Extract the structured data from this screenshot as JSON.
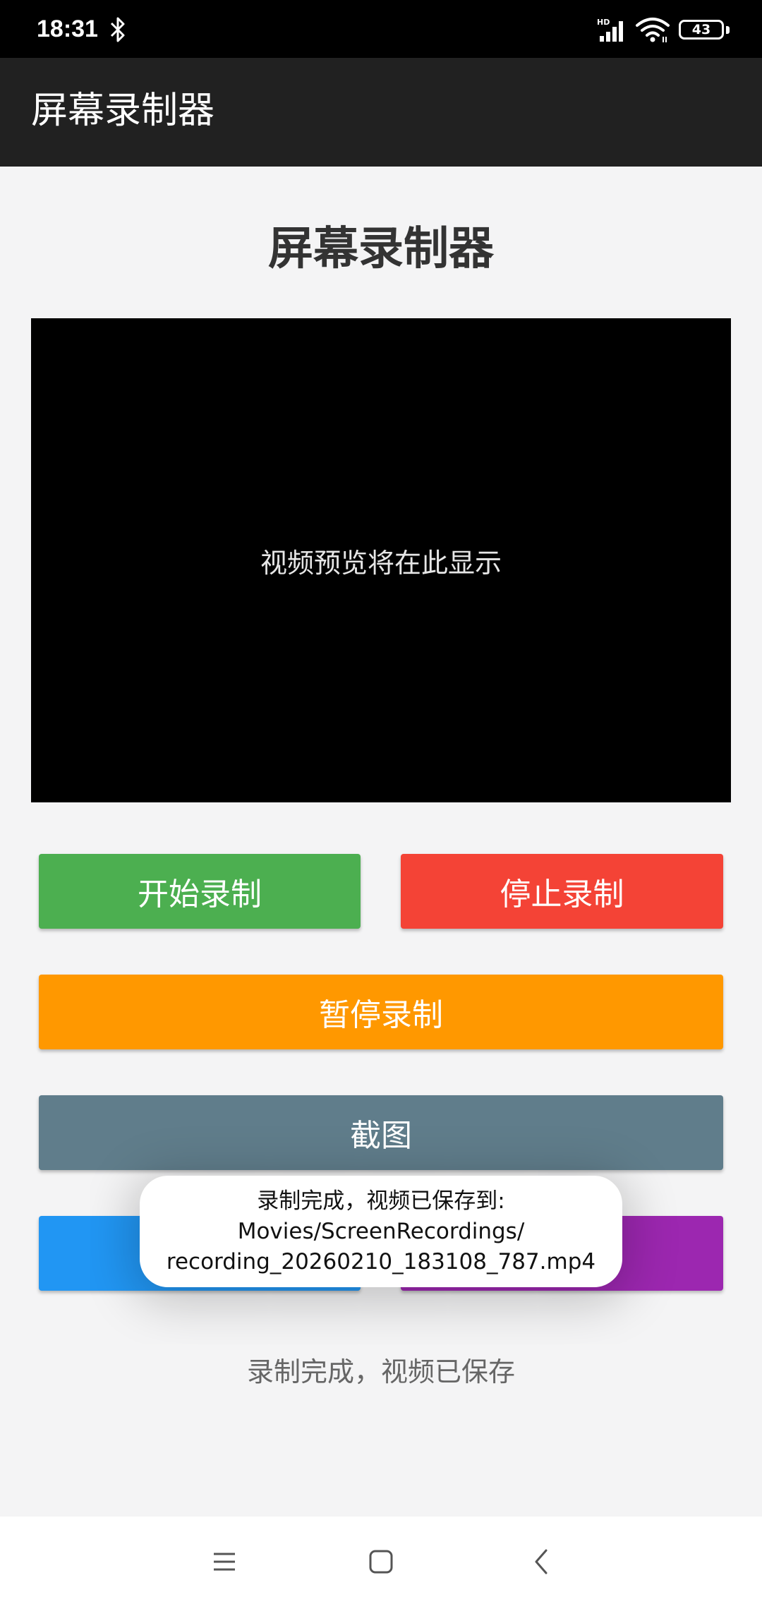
{
  "status_bar": {
    "time": "18:31",
    "battery_level": "43",
    "network_label": "HD"
  },
  "app_bar": {
    "title": "屏幕录制器"
  },
  "main": {
    "heading": "屏幕录制器",
    "preview_placeholder": "视频预览将在此显示",
    "buttons": {
      "start": "开始录制",
      "stop": "停止录制",
      "pause": "暂停录制",
      "screenshot": "截图"
    },
    "status_message": "录制完成，视频已保存"
  },
  "toast": {
    "line1": "录制完成，视频已保存到:",
    "line2": "Movies/ScreenRecordings/",
    "line3": "recording_20260210_183108_787.mp4"
  },
  "colors": {
    "start": "#4caf50",
    "stop": "#f44336",
    "pause": "#ff9800",
    "screenshot": "#607d8b",
    "blue": "#2196f3",
    "purple": "#9c27b0"
  },
  "icons": {
    "bluetooth": "bluetooth-icon",
    "signal": "cell-signal-icon",
    "wifi": "wifi-icon",
    "battery": "battery-icon",
    "nav_menu": "menu-icon",
    "nav_home": "home-icon",
    "nav_back": "back-icon"
  }
}
